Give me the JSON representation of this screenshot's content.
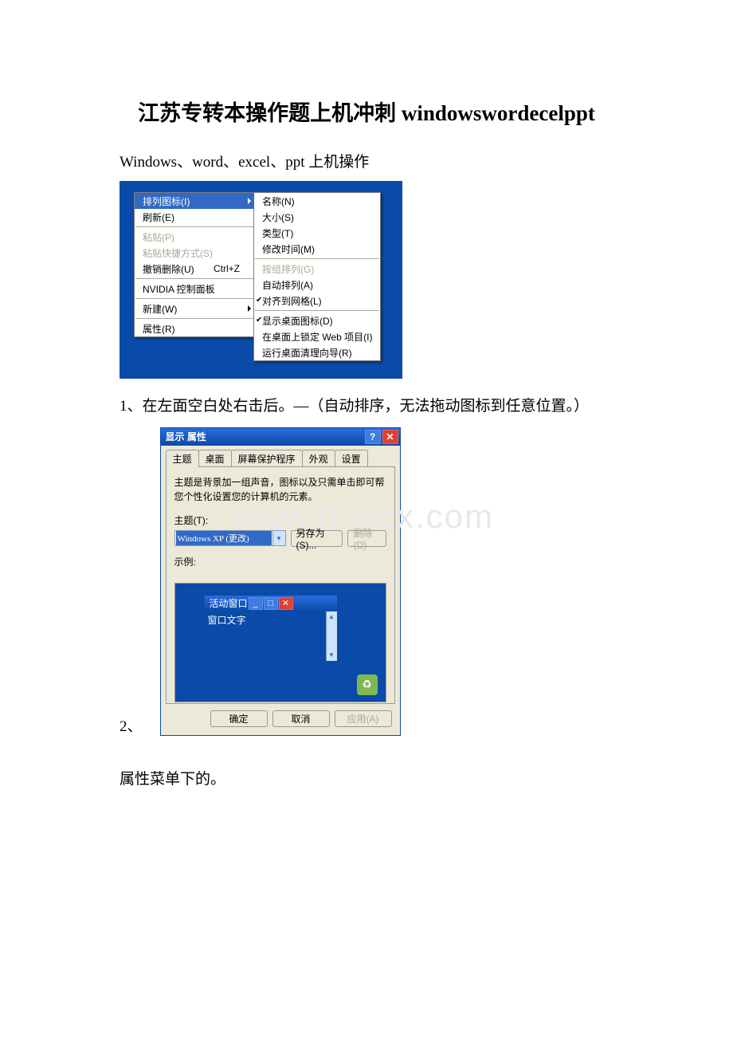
{
  "title": "江苏专转本操作题上机冲刺 windowswordecelppt",
  "intro": "Windows、word、excel、ppt 上机操作",
  "context_menu": {
    "main": [
      {
        "label": "排列图标(I)",
        "type": "submenu",
        "selected": true
      },
      {
        "label": "刷新(E)",
        "type": "item"
      },
      {
        "type": "sep"
      },
      {
        "label": "粘贴(P)",
        "type": "item",
        "disabled": true
      },
      {
        "label": "粘贴快捷方式(S)",
        "type": "item",
        "disabled": true
      },
      {
        "label": "撤销删除(U)",
        "shortcut": "Ctrl+Z",
        "type": "item"
      },
      {
        "type": "sep"
      },
      {
        "label": "NVIDIA 控制面板",
        "type": "item"
      },
      {
        "type": "sep"
      },
      {
        "label": "新建(W)",
        "type": "submenu"
      },
      {
        "type": "sep"
      },
      {
        "label": "属性(R)",
        "type": "item"
      }
    ],
    "sub": [
      {
        "label": "名称(N)"
      },
      {
        "label": "大小(S)"
      },
      {
        "label": "类型(T)"
      },
      {
        "label": "修改时间(M)"
      },
      {
        "type": "sep"
      },
      {
        "label": "按组排列(G)",
        "disabled": true
      },
      {
        "label": "自动排列(A)"
      },
      {
        "label": "对齐到网格(L)",
        "checked": true
      },
      {
        "type": "sep"
      },
      {
        "label": "显示桌面图标(D)",
        "checked": true
      },
      {
        "label": "在桌面上锁定 Web 项目(I)"
      },
      {
        "label": "运行桌面清理向导(R)"
      }
    ]
  },
  "note1": "1、在左面空白处右击后。—（自动排序，无法拖动图标到任意位置。）",
  "dialog": {
    "title": "显示 属性",
    "tabs": [
      "主题",
      "桌面",
      "屏幕保护程序",
      "外观",
      "设置"
    ],
    "active_tab": 0,
    "description": "主题是背景加一组声音，图标以及只需单击即可帮您个性化设置您的计算机的元素。",
    "theme_label": "主题(T):",
    "theme_value": "Windows XP (更改)",
    "save_as": "另存为(S)...",
    "delete": "删除(D)",
    "sample_label": "示例:",
    "inner_title": "活动窗口",
    "inner_text": "窗口文字",
    "ok": "确定",
    "cancel": "取消",
    "apply": "应用(A)"
  },
  "note2_prefix": "2、",
  "note3": "属性菜单下的。",
  "watermark": "www.bodcx.com"
}
